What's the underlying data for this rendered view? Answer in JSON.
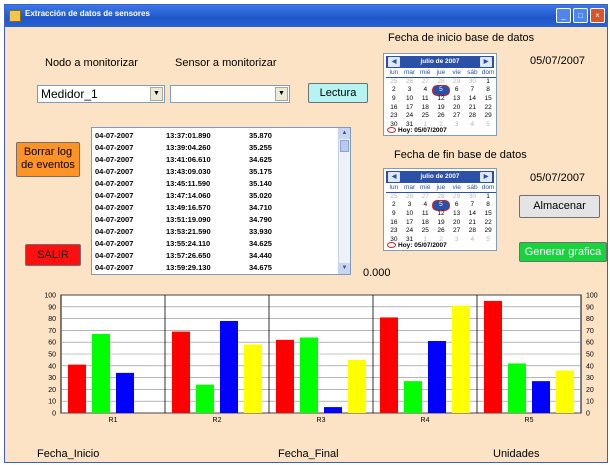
{
  "window": {
    "title": "Extracción de datos de sensores"
  },
  "labels": {
    "nodo": "Nodo a monitorizar",
    "sensor": "Sensor a monitorizar",
    "fecha_inicio_bd": "Fecha de inicio base de datos",
    "fecha_fin_bd": "Fecha de fin base de datos",
    "fecha_inicio": "Fecha_Inicio",
    "fecha_final": "Fecha_Final",
    "unidades": "Unidades"
  },
  "nodo_combo": {
    "value": "Medidor_1"
  },
  "sensor_combo": {
    "value": ""
  },
  "buttons": {
    "lectura": "Lectura",
    "borrar_log_1": "Borrar log",
    "borrar_log_2": "de eventos",
    "salir": "SALIR",
    "almacenar": "Almacenar",
    "generar": "Generar grafica"
  },
  "dates": {
    "inicio": "05/07/2007",
    "fin": "05/07/2007"
  },
  "calendar": {
    "month": "julio de 2007",
    "days_of_week": [
      "lun",
      "mar",
      "mié",
      "jue",
      "vie",
      "sáb",
      "dom"
    ],
    "weeks": [
      [
        "25",
        "26",
        "27",
        "28",
        "29",
        "30",
        "1"
      ],
      [
        "2",
        "3",
        "4",
        "5",
        "6",
        "7",
        "8"
      ],
      [
        "9",
        "10",
        "11",
        "12",
        "13",
        "14",
        "15"
      ],
      [
        "16",
        "17",
        "18",
        "19",
        "20",
        "21",
        "22"
      ],
      [
        "23",
        "24",
        "25",
        "26",
        "27",
        "28",
        "29"
      ],
      [
        "30",
        "31",
        "1",
        "2",
        "3",
        "4",
        "5"
      ]
    ],
    "selected_day": "5",
    "today": "Hoy: 05/07/2007"
  },
  "log": {
    "rows": [
      [
        "04-07-2007",
        "13:37:01.890",
        "35.870"
      ],
      [
        "04-07-2007",
        "13:39:04.260",
        "35.255"
      ],
      [
        "04-07-2007",
        "13:41:06.610",
        "34.625"
      ],
      [
        "04-07-2007",
        "13:43:09.030",
        "35.175"
      ],
      [
        "04-07-2007",
        "13:45:11.590",
        "35.140"
      ],
      [
        "04-07-2007",
        "13:47:14.060",
        "35.020"
      ],
      [
        "04-07-2007",
        "13:49:16.570",
        "34.710"
      ],
      [
        "04-07-2007",
        "13:51:19.090",
        "34.790"
      ],
      [
        "04-07-2007",
        "13:53:21.590",
        "33.930"
      ],
      [
        "04-07-2007",
        "13:55:24.110",
        "34.625"
      ],
      [
        "04-07-2007",
        "13:57:26.650",
        "34.440"
      ],
      [
        "04-07-2007",
        "13:59:29.130",
        "34.675"
      ]
    ]
  },
  "reading": "0.000",
  "chart_data": {
    "type": "bar",
    "categories": [
      "R1",
      "R2",
      "R3",
      "R4",
      "R5"
    ],
    "series": [
      {
        "color": "#ff0000",
        "values": [
          41,
          69,
          62,
          81,
          95
        ]
      },
      {
        "color": "#00ff00",
        "values": [
          67,
          24,
          64,
          27,
          42
        ]
      },
      {
        "color": "#0000ff",
        "values": [
          34,
          78,
          5,
          61,
          27
        ]
      },
      {
        "color": "#ffff00",
        "values": [
          0,
          58,
          45,
          91,
          36
        ]
      }
    ],
    "ylim": [
      0,
      100
    ],
    "yticks": [
      0,
      10,
      20,
      30,
      40,
      50,
      60,
      70,
      80,
      90,
      100
    ],
    "grid": true
  }
}
